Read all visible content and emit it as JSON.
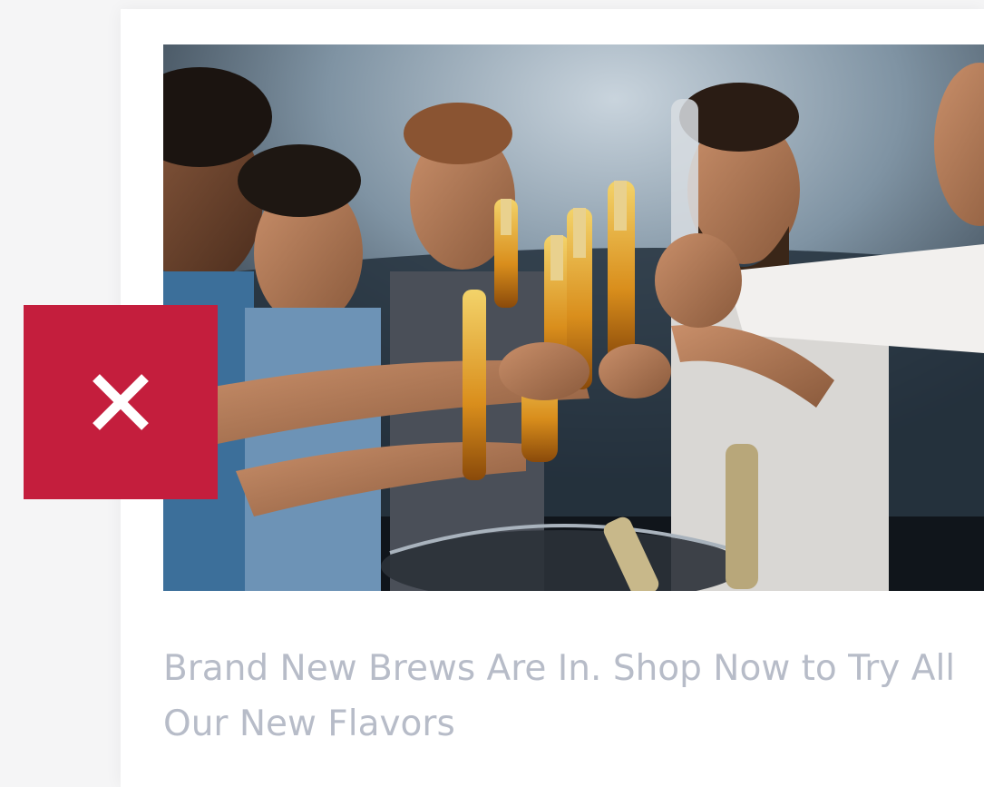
{
  "promo": {
    "image_alt": "Group of friends toasting with beer bottles",
    "headline": "Brand New Brews Are In. Shop Now to Try All Our New Flavors",
    "close_label": "Close"
  },
  "colors": {
    "accent": "#c41e3d",
    "headline_text": "#b7bcc8",
    "card_background": "#ffffff",
    "page_background": "#f5f5f6"
  },
  "icons": {
    "close": "close-icon"
  }
}
